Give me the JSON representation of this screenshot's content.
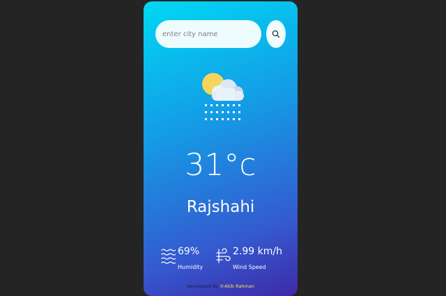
{
  "search": {
    "placeholder": "enter city name"
  },
  "weather": {
    "icon": "sun-behind-cloud-snow-icon",
    "temperature": "31°c",
    "city": "Rajshahi"
  },
  "details": {
    "humidity": {
      "icon": "humidity-waves-icon",
      "value": "69%",
      "label": "Humidity"
    },
    "wind": {
      "icon": "wind-icon",
      "value": "2.99 km/h",
      "label": "Wind Speed"
    }
  },
  "footer": {
    "prefix": "Developed By",
    "author": "©Akib Rahman"
  },
  "colors": {
    "background": "#242424",
    "card_gradient_start": "#00d8f4",
    "card_gradient_end": "#3d2aa8",
    "author_highlight": "#ffe34a"
  }
}
